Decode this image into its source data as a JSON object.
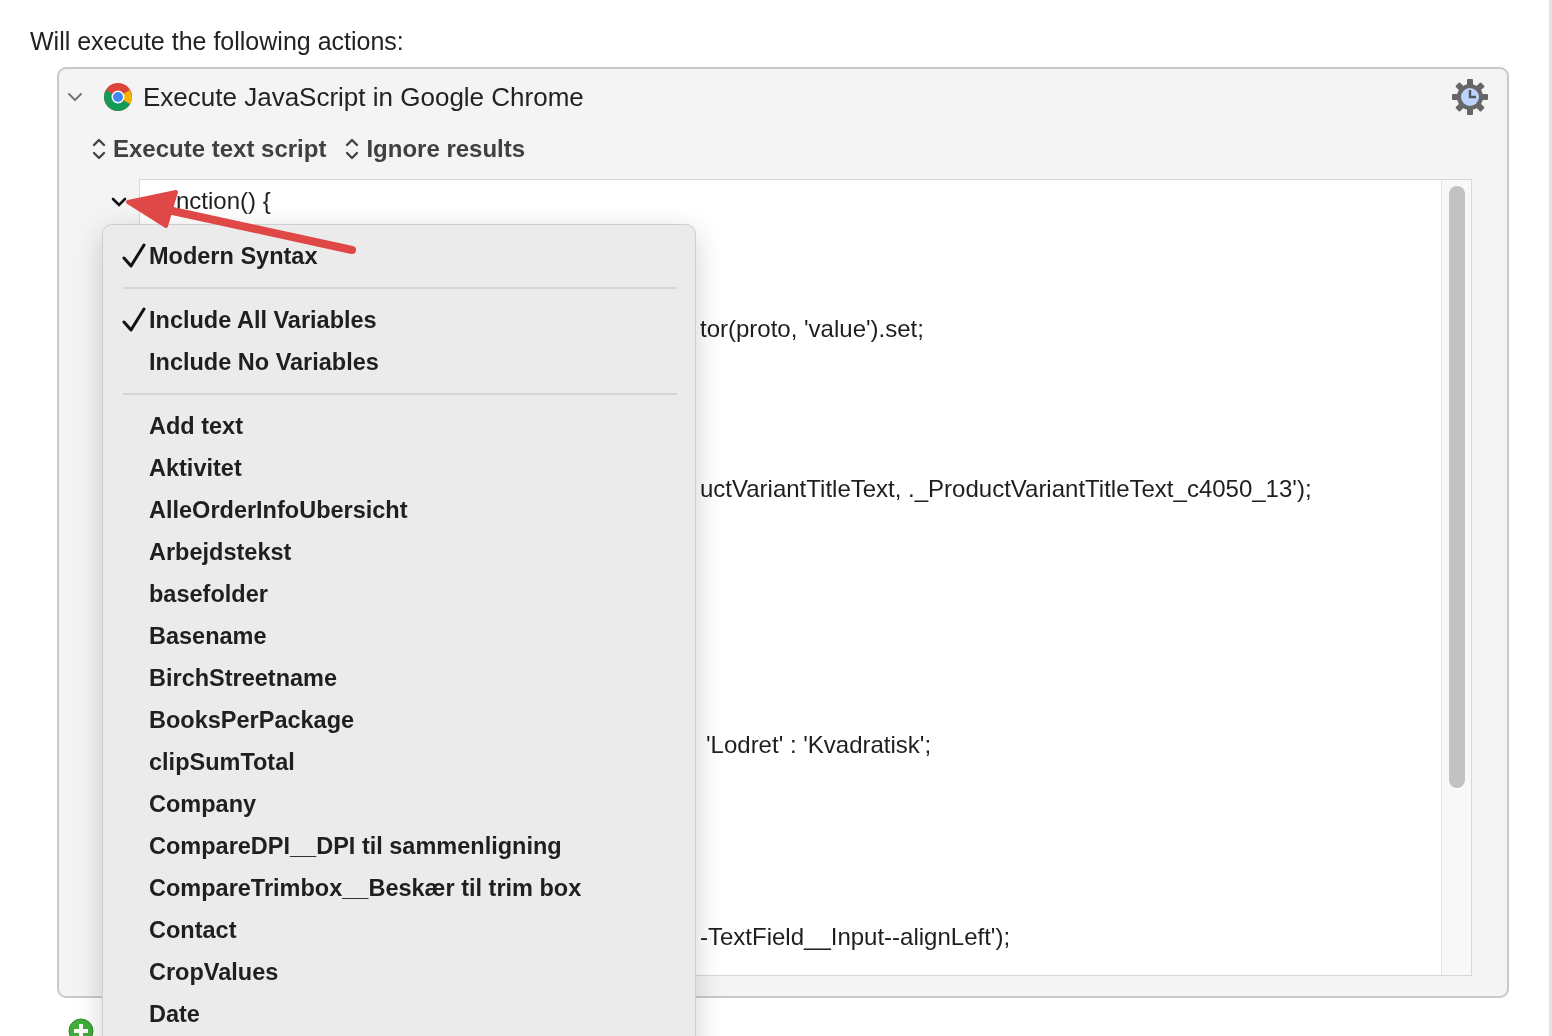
{
  "intro": "Will execute the following actions:",
  "action": {
    "title": "Execute JavaScript in Google Chrome",
    "expanded": true,
    "popups": [
      "Execute text script",
      "Ignore results"
    ],
    "code_expanded": true,
    "code_lines": [
      "nction() {",
      "tor(proto, 'value').set;",
      "uctVariantTitleText, ._ProductVariantTitleText_c4050_13');",
      "'Lodret' : 'Kvadratisk';",
      "-TextField__Input--alignLeft');"
    ]
  },
  "menu": {
    "sections": [
      {
        "items": [
          {
            "label": "Modern Syntax",
            "checked": true
          }
        ]
      },
      {
        "items": [
          {
            "label": "Include All Variables",
            "checked": true
          },
          {
            "label": "Include No Variables",
            "checked": false
          }
        ]
      },
      {
        "items": [
          {
            "label": "Add text",
            "checked": false
          },
          {
            "label": "Aktivitet",
            "checked": false
          },
          {
            "label": "AlleOrderInfoUbersicht",
            "checked": false
          },
          {
            "label": "Arbejdstekst",
            "checked": false
          },
          {
            "label": "basefolder",
            "checked": false
          },
          {
            "label": "Basename",
            "checked": false
          },
          {
            "label": "BirchStreetname",
            "checked": false
          },
          {
            "label": "BooksPerPackage",
            "checked": false
          },
          {
            "label": "clipSumTotal",
            "checked": false
          },
          {
            "label": "Company",
            "checked": false
          },
          {
            "label": "CompareDPI__DPI til sammenligning",
            "checked": false
          },
          {
            "label": "CompareTrimbox__Beskær til trim box",
            "checked": false
          },
          {
            "label": "Contact",
            "checked": false
          },
          {
            "label": "CropValues",
            "checked": false
          },
          {
            "label": "Date",
            "checked": false
          }
        ]
      }
    ]
  }
}
